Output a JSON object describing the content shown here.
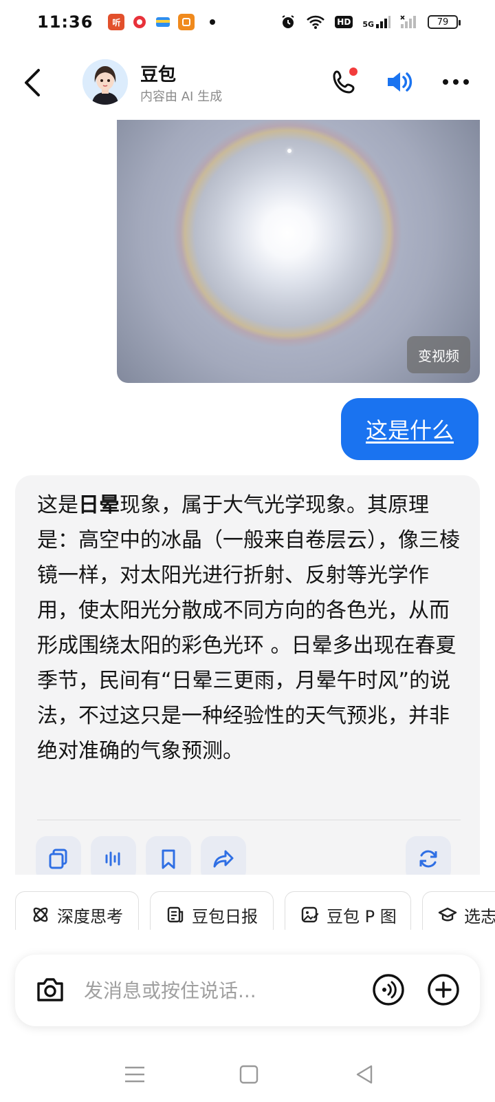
{
  "status": {
    "time": "11:36",
    "battery": "79",
    "network": "HD",
    "signal": "5G"
  },
  "header": {
    "name": "豆包",
    "subtitle": "内容由 AI 生成"
  },
  "image": {
    "convert_label": "变视频"
  },
  "user_message": "这是什么",
  "ai_message": {
    "lead": "这是",
    "bold": "日晕",
    "body": "现象，属于大气光学现象。其原理是：高空中的冰晶（一般来自卷层云），像三棱镜一样，对太阳光进行折射、反射等光学作用，使太阳光分散成不同方向的各色光，从而形成围绕太阳的彩色光环 。日晕多出现在春夏季节，民间有“日晕三更雨，月晕午时风”的说法，不过这只是一种经验性的天气预兆，并非绝对准确的气象预测。"
  },
  "chips": [
    {
      "label": "深度思考",
      "icon": "atom-icon"
    },
    {
      "label": "豆包日报",
      "icon": "newspaper-icon"
    },
    {
      "label": "豆包 P 图",
      "icon": "image-edit-icon"
    },
    {
      "label": "选志",
      "icon": "graduation-cap-icon"
    }
  ],
  "input": {
    "placeholder": "发消息或按住说话..."
  },
  "colors": {
    "accent": "#1a73f0",
    "card_bg": "#f4f4f5",
    "notification": "#f23c3c"
  }
}
